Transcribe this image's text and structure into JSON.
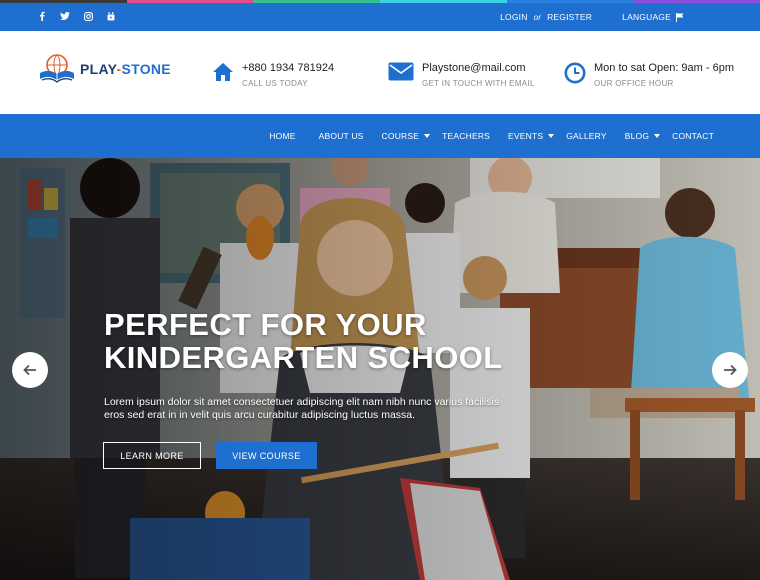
{
  "topbar": {
    "rainbow_colors": [
      "#3a3a3a",
      "#e24e8a",
      "#36c08a",
      "#3ad1e0",
      "#2a7fe0",
      "#8c4fe0"
    ],
    "social_icons": [
      "facebook-icon",
      "twitter-icon",
      "instagram-icon",
      "youtube-icon"
    ],
    "login_label": "LOGIN",
    "or_label": "or",
    "register_label": "REGISTER",
    "language_label": "LANGUAGE",
    "language_icon": "flag-icon"
  },
  "header": {
    "logo": {
      "part1": "PLAY",
      "dash": "-",
      "part2": "STONE",
      "icon": "book-globe-logo-icon"
    },
    "phone": {
      "icon": "home-icon",
      "title": "+880 1934 781924",
      "subtitle": "CALL US TODAY"
    },
    "email": {
      "icon": "envelope-icon",
      "title": "Playstone@mail.com",
      "subtitle": "GET IN TOUCH WITH EMAIL"
    },
    "hours": {
      "icon": "clock-icon",
      "title": "Mon to sat Open: 9am - 6pm",
      "subtitle": "OUR OFFICE HOUR"
    }
  },
  "nav": {
    "items": [
      {
        "label": "HOME",
        "dropdown": false
      },
      {
        "label": "ABOUT US",
        "dropdown": false
      },
      {
        "label": "COURSE",
        "dropdown": true
      },
      {
        "label": "TEACHERS",
        "dropdown": false
      },
      {
        "label": "EVENTS",
        "dropdown": true
      },
      {
        "label": "GALLERY",
        "dropdown": false
      },
      {
        "label": "BLOG",
        "dropdown": true
      },
      {
        "label": "CONTACT",
        "dropdown": false
      }
    ]
  },
  "hero": {
    "title_line1": "PERFECT FOR YOUR",
    "title_line2": "KINDERGARTEN SCHOOL",
    "description": "Lorem ipsum dolor sit amet consectetuer adipiscing elit nam nibh nunc varius facilisis eros sed erat in in velit quis arcu curabitur adipiscing luctus massa.",
    "learn_more_label": "LEARN MORE",
    "view_course_label": "VIEW COURSE",
    "prev_icon": "arrow-left-icon",
    "next_icon": "arrow-right-icon"
  },
  "colors": {
    "primary": "#1e6fd0",
    "logo_dark": "#1e3f6e",
    "logo_accent": "#e65b2a"
  }
}
